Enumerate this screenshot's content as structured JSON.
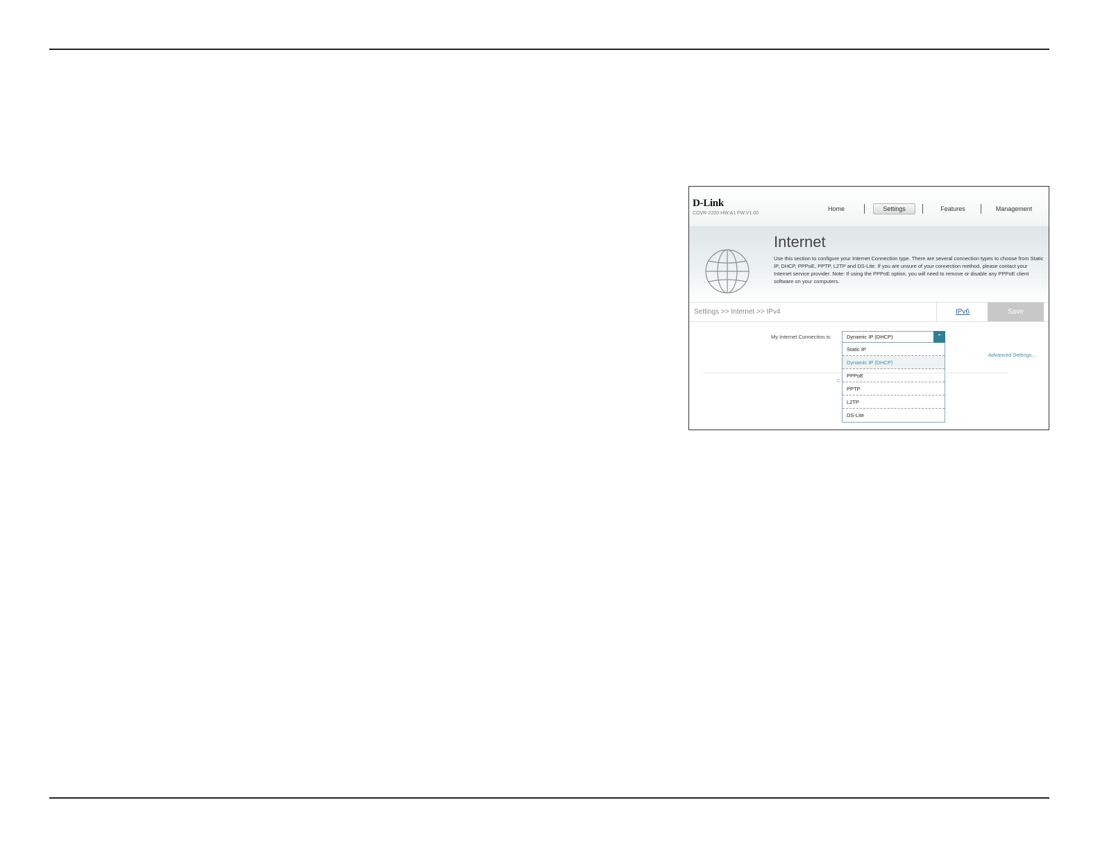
{
  "router_ui": {
    "logo": "D-Link",
    "model": "COVR-2200 HW:A1 FW:V1.00",
    "nav": [
      {
        "label": "Home"
      },
      {
        "label": "Settings"
      },
      {
        "label": "Features"
      },
      {
        "label": "Management"
      }
    ],
    "active_nav": "Settings",
    "banner": {
      "title": "Internet",
      "description": "Use this section to configure your Internet Connection type. There are several connection types to choose from Static IP, DHCP, PPPoE, PPTP, L2TP and DS-Lite. If you are unsure of your connection method, please contact your Internet service provider. Note: If using the PPPoE option, you will need to remove or disable any PPPoE client software on your computers."
    },
    "breadcrumb": "Settings >> Internet >> IPv4",
    "ipv6_tab": "IPv6",
    "save_label": "Save",
    "connection_label": "My Internet Connection is:",
    "connection_value": "Dynamic IP (DHCP)",
    "dropdown_options": [
      {
        "label": "Static IP"
      },
      {
        "label": "Dynamic IP (DHCP)"
      },
      {
        "label": "PPPoE"
      },
      {
        "label": "PPTP"
      },
      {
        "label": "L2TP"
      },
      {
        "label": "DS-Lite"
      }
    ],
    "selected_option": "Dynamic IP (DHCP)",
    "advanced_link": "Advanced Settings...",
    "partial_text": "C"
  },
  "colors": {
    "accent": "#2f7f95",
    "link": "#4a87a8",
    "save_disabled": "#c8c8c8"
  }
}
